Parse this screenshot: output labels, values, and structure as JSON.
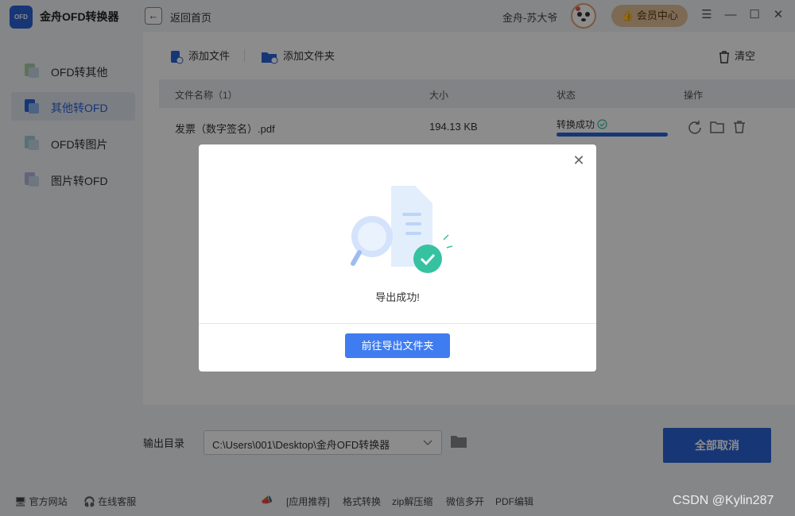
{
  "app": {
    "logo_text": "OFD",
    "title": "金舟OFD转换器"
  },
  "header": {
    "back_icon": "arrow-left-icon",
    "back_label": "返回首页",
    "username": "金舟-苏大爷",
    "vip_label": "会员中心",
    "menu_icon": "☰",
    "minimize_icon": "—",
    "maximize_icon": "☐",
    "close_icon": "✕"
  },
  "sidebar": {
    "items": [
      {
        "label": "OFD转其他",
        "active": false
      },
      {
        "label": "其他转OFD",
        "active": true
      },
      {
        "label": "OFD转图片",
        "active": false
      },
      {
        "label": "图片转OFD",
        "active": false
      }
    ]
  },
  "toolbar": {
    "add_file": "添加文件",
    "add_folder": "添加文件夹",
    "clear": "清空"
  },
  "table": {
    "columns": {
      "name": "文件名称（1）",
      "size": "大小",
      "status": "状态",
      "actions": "操作"
    },
    "rows": [
      {
        "name": "发票（数字签名）.pdf",
        "size": "194.13 KB",
        "status": "转换成功",
        "progress": 1.0
      }
    ]
  },
  "output": {
    "label": "输出目录",
    "path": "C:\\Users\\001\\Desktop\\金舟OFD转换器",
    "cancel_all": "全部取消"
  },
  "footer": {
    "website": "官方网站",
    "support": "在线客服",
    "recommend": "[应用推荐]",
    "links": [
      "格式转换",
      "zip解压缩",
      "微信多开",
      "PDF编辑"
    ]
  },
  "modal": {
    "message": "导出成功!",
    "button": "前往导出文件夹"
  },
  "watermark": "CSDN @Kylin287",
  "colors": {
    "accent": "#2a63d6",
    "modal_button": "#3f7cf0",
    "success": "#36c2a0",
    "vip": "#e4c29a"
  }
}
